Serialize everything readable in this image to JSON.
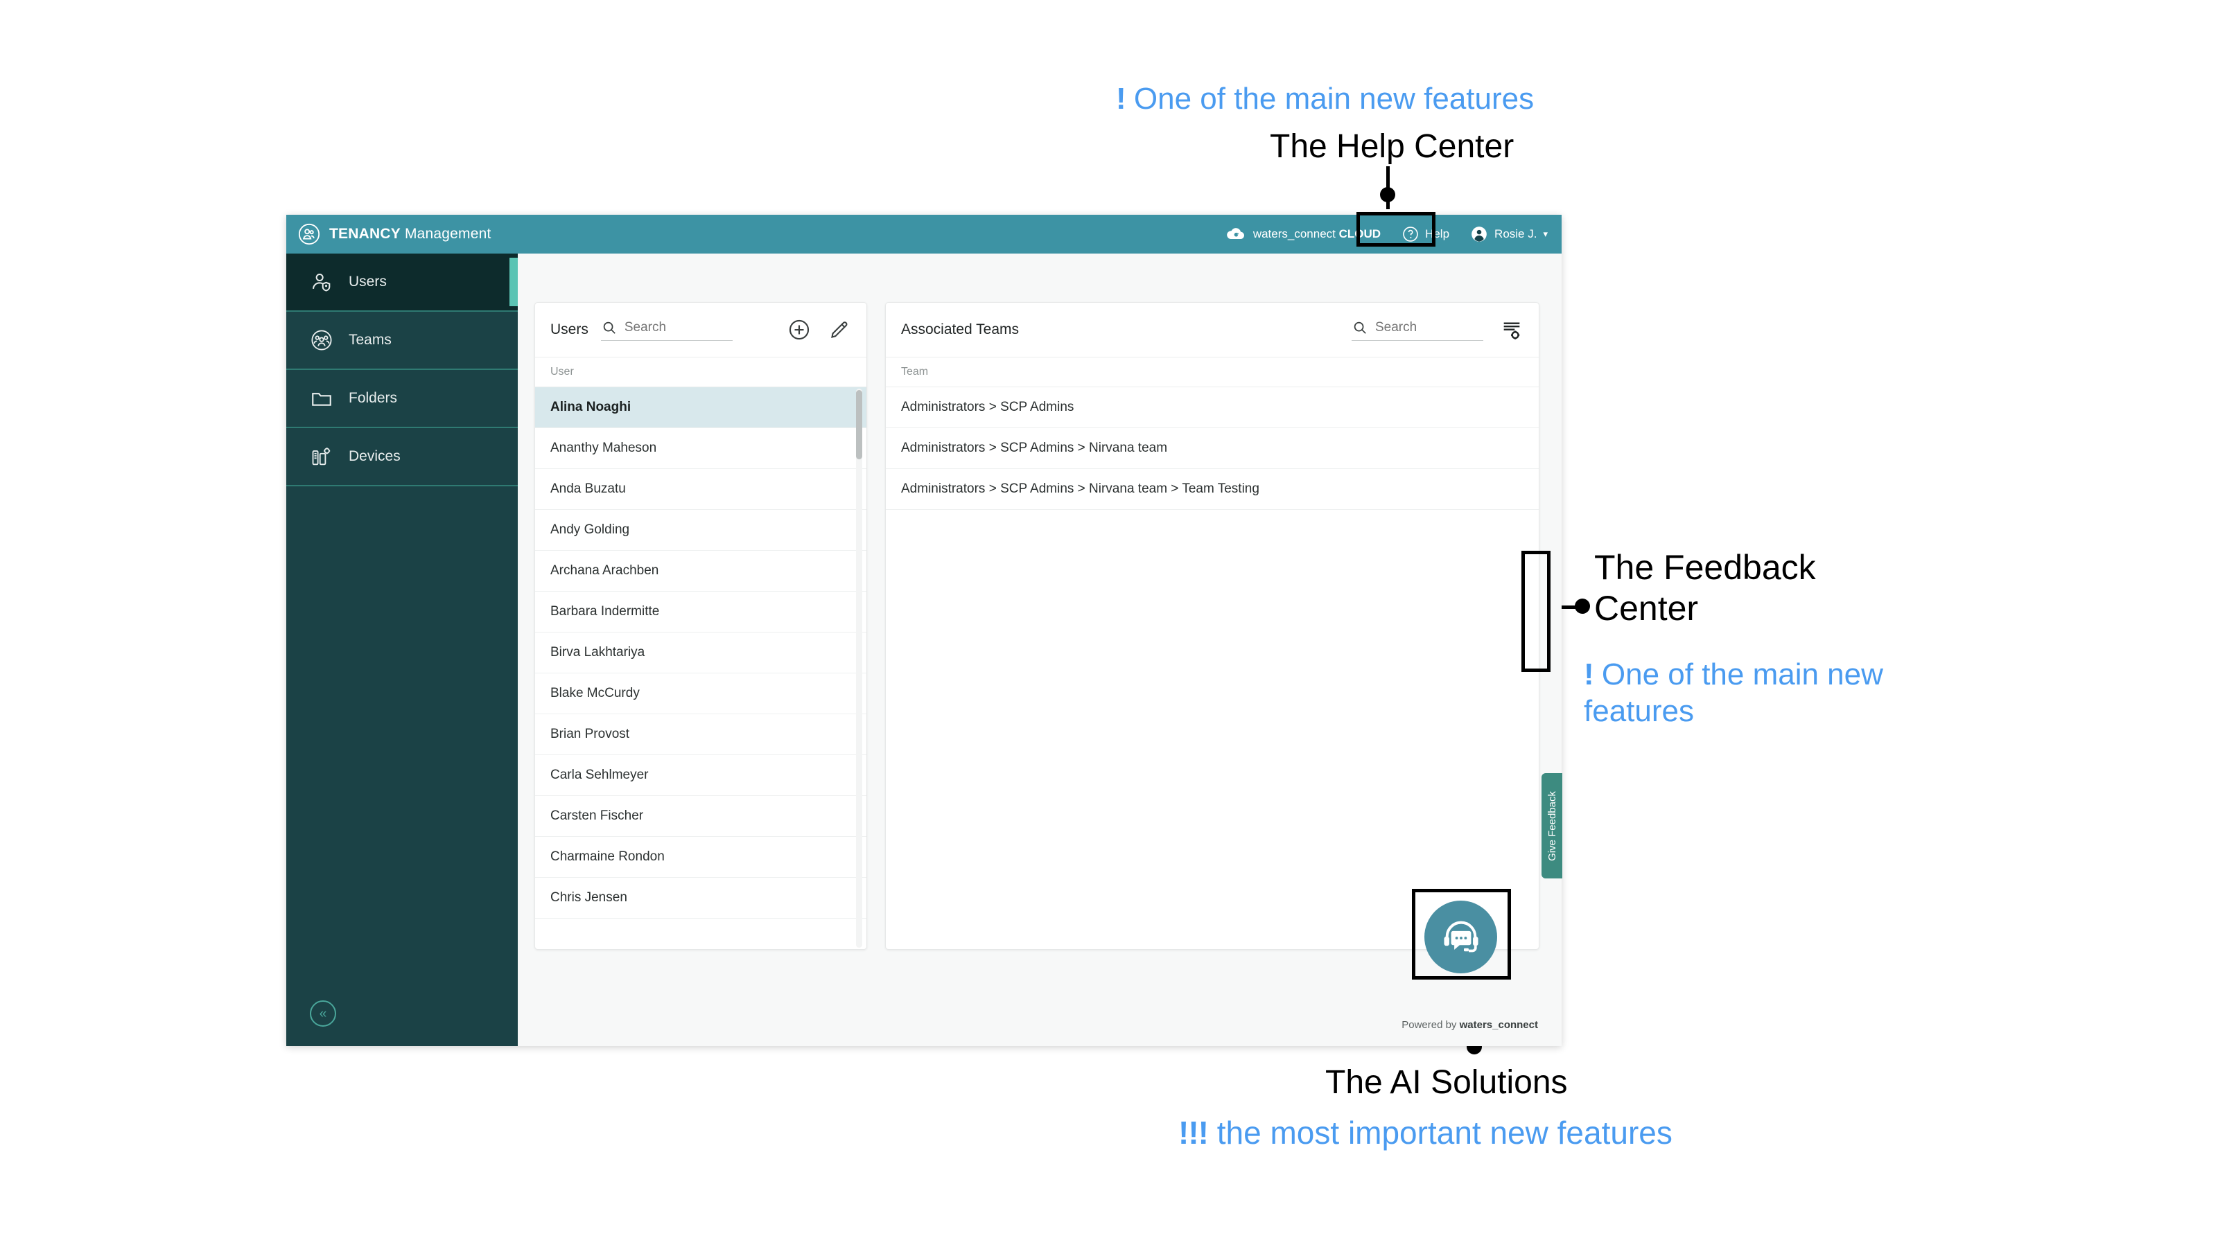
{
  "annotations": [
    {
      "id": "help",
      "blue_text": "One of the main new features",
      "bang": "!",
      "black_text": "The Help Center"
    },
    {
      "id": "feedback",
      "black_text": "The Feedback Center",
      "bang": "!",
      "blue_text": "One of the main new features"
    },
    {
      "id": "ai",
      "black_text": "The AI Solutions",
      "bang": "!!!",
      "blue_text": "the most important new features"
    }
  ],
  "colors": {
    "header_teal": "#3d93a4",
    "sidebar_dark": "#1b4246",
    "sidebar_active": "#0d2b2c",
    "accent_teal": "#5bc4b4",
    "feedback_tab": "#3d8b80",
    "annotation_blue": "#4a9bf0",
    "selected_row": "#d8e8ec",
    "ai_fab": "#4a8fa2"
  },
  "topbar": {
    "brand_bold": "TENANCY",
    "brand_light": " Management",
    "brand_icon": "tenancy-users-icon",
    "cloud_label_light": "waters_connect ",
    "cloud_label_bold": "CLOUD",
    "cloud_icon": "cloud-icon",
    "help_label": "Help",
    "help_icon": "question-circle-icon",
    "user_name": "Rosie J.",
    "user_icon": "avatar-icon",
    "caret_icon": "chevron-down-icon"
  },
  "sidebar": {
    "items": [
      {
        "label": "Users",
        "icon": "user-shield-icon",
        "active": true
      },
      {
        "label": "Teams",
        "icon": "team-circle-icon",
        "active": false
      },
      {
        "label": "Folders",
        "icon": "folder-icon",
        "active": false
      },
      {
        "label": "Devices",
        "icon": "devices-gear-icon",
        "active": false
      }
    ],
    "collapse_icon": "chevron-double-left-icon"
  },
  "users_panel": {
    "title": "Users",
    "search_placeholder": "Search",
    "search_value": "",
    "search_icon": "search-icon",
    "add_icon": "plus-circle-icon",
    "edit_icon": "pencil-icon",
    "column_header": "User",
    "rows": [
      {
        "name": "Alina Noaghi",
        "selected": true
      },
      {
        "name": "Ananthy Maheson",
        "selected": false
      },
      {
        "name": "Anda Buzatu",
        "selected": false
      },
      {
        "name": "Andy Golding",
        "selected": false
      },
      {
        "name": "Archana Arachben",
        "selected": false
      },
      {
        "name": "Barbara Indermitte",
        "selected": false
      },
      {
        "name": "Birva Lakhtariya",
        "selected": false
      },
      {
        "name": "Blake McCurdy",
        "selected": false
      },
      {
        "name": "Brian Provost",
        "selected": false
      },
      {
        "name": "Carla Sehlmeyer",
        "selected": false
      },
      {
        "name": "Carsten Fischer",
        "selected": false
      },
      {
        "name": "Charmaine Rondon",
        "selected": false
      },
      {
        "name": "Chris Jensen",
        "selected": false
      }
    ]
  },
  "teams_panel": {
    "title": "Associated Teams",
    "search_placeholder": "Search",
    "search_value": "",
    "search_icon": "search-icon",
    "settings_icon": "list-settings-icon",
    "column_header": "Team",
    "rows": [
      {
        "name": "Administrators > SCP Admins"
      },
      {
        "name": "Administrators > SCP Admins > Nirvana team"
      },
      {
        "name": "Administrators > SCP Admins > Nirvana team > Team Testing"
      }
    ]
  },
  "feedback_tab": {
    "label": "Give Feedback"
  },
  "ai_fab": {
    "icon": "headset-chat-icon"
  },
  "footer": {
    "prefix": "Powered by ",
    "brand": "waters_connect"
  }
}
